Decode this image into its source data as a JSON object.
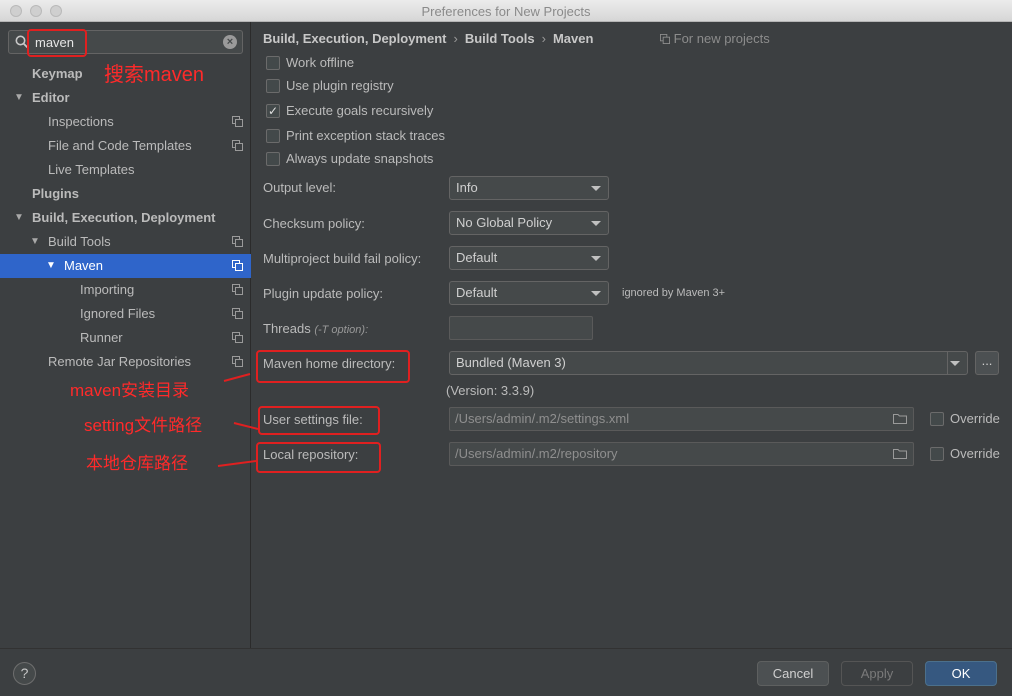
{
  "window": {
    "title": "Preferences for New Projects"
  },
  "search": {
    "value": "maven"
  },
  "sidebar": {
    "items": [
      {
        "label": "Keymap"
      },
      {
        "label": "Editor"
      },
      {
        "label": "Inspections"
      },
      {
        "label": "File and Code Templates"
      },
      {
        "label": "Live Templates"
      },
      {
        "label": "Plugins"
      },
      {
        "label": "Build, Execution, Deployment"
      },
      {
        "label": "Build Tools"
      },
      {
        "label": "Maven"
      },
      {
        "label": "Importing"
      },
      {
        "label": "Ignored Files"
      },
      {
        "label": "Runner"
      },
      {
        "label": "Remote Jar Repositories"
      }
    ],
    "selected": "Maven"
  },
  "breadcrumb": {
    "parts": [
      "Build, Execution, Deployment",
      "Build Tools",
      "Maven"
    ],
    "separator": "›",
    "scope": "For new projects"
  },
  "checkboxes": [
    {
      "label": "Work offline",
      "checked": false
    },
    {
      "label": "Use plugin registry",
      "checked": false
    },
    {
      "label": "Execute goals recursively",
      "checked": true
    },
    {
      "label": "Print exception stack traces",
      "checked": false
    },
    {
      "label": "Always update snapshots",
      "checked": false
    }
  ],
  "checkmark": "✓",
  "fields": {
    "output_level": {
      "label": "Output level:",
      "value": "Info"
    },
    "checksum_policy": {
      "label": "Checksum policy:",
      "value": "No Global Policy"
    },
    "multiproject_policy": {
      "label": "Multiproject build fail policy:",
      "value": "Default"
    },
    "plugin_update_policy": {
      "label": "Plugin update policy:",
      "value": "Default",
      "note": "ignored by Maven 3+"
    },
    "threads": {
      "label": "Threads",
      "hint": "(-T option):",
      "value": ""
    },
    "maven_home": {
      "label": "Maven home directory:",
      "value": "Bundled (Maven 3)",
      "browse": "...",
      "version": "(Version: 3.3.9)"
    },
    "user_settings": {
      "label": "User settings file:",
      "value": "/Users/admin/.m2/settings.xml",
      "override": "Override"
    },
    "local_repo": {
      "label": "Local repository:",
      "value": "/Users/admin/.m2/repository",
      "override": "Override"
    }
  },
  "annotations": {
    "search_note": "搜索maven",
    "home_note": "maven安装目录",
    "settings_note": "setting文件路径",
    "repo_note": "本地仓库路径",
    "color": "#e02020"
  },
  "buttons": {
    "help": "?",
    "cancel": "Cancel",
    "apply": "Apply",
    "ok": "OK"
  },
  "colors": {
    "background": "#3c3f41",
    "selection": "#2f65ca",
    "ok_button": "#365880"
  }
}
